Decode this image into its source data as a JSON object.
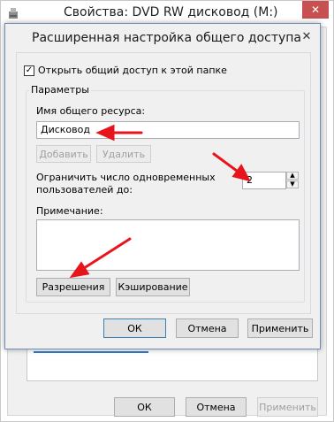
{
  "outer_window": {
    "title": "Свойства: DVD RW дисковод (M:)",
    "close_glyph": "✕",
    "buttons": {
      "ok": "ОК",
      "cancel": "Отмена",
      "apply": "Применить"
    }
  },
  "dialog": {
    "title": "Расширенная настройка общего доступа",
    "close_glyph": "✕",
    "share_checkbox": {
      "checked": true,
      "check_glyph": "✓",
      "label": "Открыть общий доступ к этой папке"
    },
    "params_group": {
      "title": "Параметры",
      "share_name_label": "Имя общего ресурса:",
      "share_name_value": "Дисковод",
      "add_button": "Добавить",
      "remove_button": "Удалить",
      "limit_label_line1": "Ограничить число одновременных",
      "limit_label_line2": "пользователей до:",
      "limit_value": "2",
      "spin_up_glyph": "▲",
      "spin_down_glyph": "▼",
      "comment_label": "Примечание:",
      "permissions_button": "Разрешения",
      "caching_button": "Кэширование"
    },
    "buttons": {
      "ok": "ОК",
      "cancel": "Отмена",
      "apply": "Применить"
    }
  },
  "annotation_color": "#e8141b"
}
